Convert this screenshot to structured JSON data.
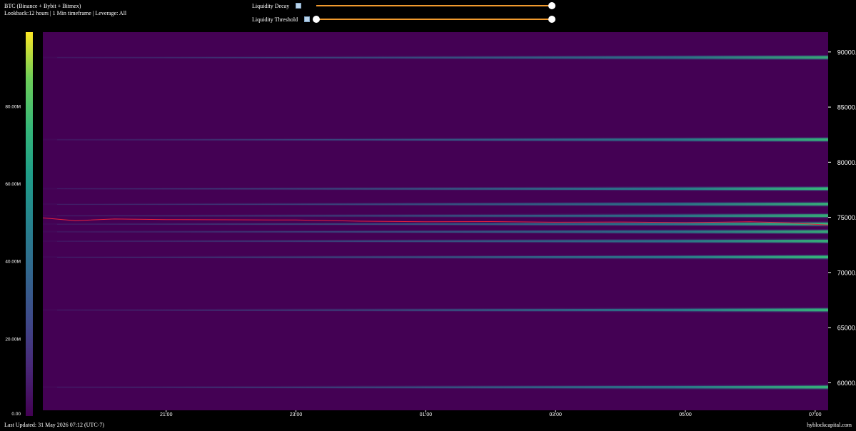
{
  "header": {
    "title": "BTC (Binance + Bybit + Bitmex)",
    "subtitle": "Lookback:12 hours | 1 Min timeframe | Leverage: All"
  },
  "controls": {
    "decay_label": "Liquidity Decay",
    "threshold_label": "Liquidity Threshold",
    "decay_value": 1.0,
    "threshold_range": [
      0.0,
      1.0
    ]
  },
  "footer": {
    "updated": "Last Updated: 31 May 2026 07:12 (UTC-7)",
    "source": "hyblockcapital.com"
  },
  "colors": {
    "background": "#000000",
    "heatmap_base": "#440154",
    "price_line": "#e8213d",
    "slider": "#f09a2e"
  },
  "chart_data": {
    "type": "heatmap",
    "x_ticks": [
      "21:00",
      "23:00",
      "01:00",
      "03:00",
      "05:00",
      "07:00"
    ],
    "x_tick_hours": [
      21,
      23,
      25,
      27,
      29,
      31
    ],
    "x_range_hours": [
      19.1,
      31.2
    ],
    "y_ticks": [
      60000,
      65000,
      70000,
      75000,
      80000,
      85000,
      90000
    ],
    "y_tick_labels": [
      "60000.0",
      "65000.0",
      "70000.0",
      "75000.0",
      "80000.0",
      "85000.0",
      "90000.0"
    ],
    "ylim": [
      57500,
      91800
    ],
    "colorbar": {
      "ticks": [
        0,
        20,
        40,
        60,
        80
      ],
      "tick_labels": [
        "0.00",
        "20.00M",
        "40.00M",
        "60.00M",
        "80.00M"
      ],
      "range_m": [
        0,
        99
      ],
      "colormap": "viridis"
    },
    "liquidity_bands": [
      {
        "price": 89500,
        "intensity": 0.35
      },
      {
        "price": 82050,
        "intensity": 0.45
      },
      {
        "price": 77600,
        "intensity": 0.5
      },
      {
        "price": 76200,
        "intensity": 0.4
      },
      {
        "price": 75150,
        "intensity": 0.38
      },
      {
        "price": 74400,
        "intensity": 0.45
      },
      {
        "price": 73700,
        "intensity": 0.35
      },
      {
        "price": 72850,
        "intensity": 0.4
      },
      {
        "price": 71400,
        "intensity": 0.55
      },
      {
        "price": 66600,
        "intensity": 0.45
      },
      {
        "price": 59600,
        "intensity": 0.45
      }
    ],
    "price_series": {
      "name": "BTC price",
      "hours": [
        19.1,
        19.6,
        20.2,
        21.0,
        22.0,
        23.0,
        24.0,
        25.0,
        26.0,
        27.0,
        28.0,
        29.0,
        30.0,
        30.6,
        31.2
      ],
      "values": [
        74950,
        74700,
        74850,
        74800,
        74780,
        74760,
        74650,
        74600,
        74620,
        74560,
        74580,
        74520,
        74600,
        74500,
        74300
      ]
    }
  }
}
